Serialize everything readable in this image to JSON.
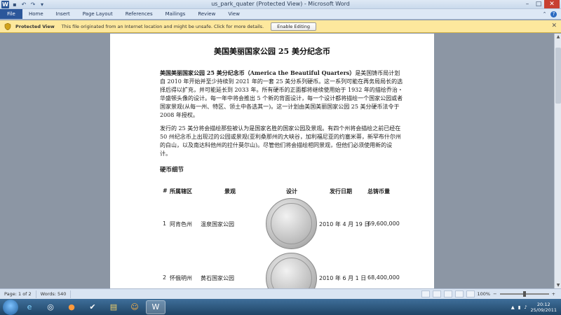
{
  "window": {
    "title": "us_park_quater (Protected View) - Microsoft Word",
    "app_icon": "W"
  },
  "ribbon": {
    "file_tab": "File",
    "tabs": [
      "Home",
      "Insert",
      "Page Layout",
      "References",
      "Mailings",
      "Review",
      "View"
    ]
  },
  "protected_view": {
    "title": "Protected View",
    "message": "This file originated from an Internet location and might be unsafe. Click for more details.",
    "button": "Enable Editing"
  },
  "document": {
    "title": "美国美丽国家公园 25 美分纪念币",
    "p1_bold": "美国美丽国家公园 25 美分纪念币（America the Beautiful Quarters）",
    "p1_rest": "是美国铸币局计划自 2010 年开始并至少持续到 2021 年的一套 25 美分系列硬币。这一系列可能在再务局局长的选择后得以扩充，并可能延长到 2033 年。所有硬币的正面都将继续使用始于 1932 年的描绘乔治・华盛顿头像的设计。每一年中将会推出 5 个新的背面设计，每一个设计都将描绘一个国家公园或者国家景观(从每一州、特区、领土中各选其一)。这一计划由美国美丽国家公园 25 美分硬币法令于 2008 年授权。",
    "p2": "发行的 25 美分将会描绘那些被认为是国家名胜的国家公园及景观。有四个州将会描绘之前已经在 50 州纪念币上出现过的公园或景观(亚利桑那州的大峡谷，加利福尼亚的约塞米蒂，新罕布什尔州的白山，以及南达科他州的拉什莫尔山)。尽管他们将会描绘相同景观，但他们必须使用新的设计。",
    "section_heading": "硬币细节",
    "table": {
      "headers": [
        "#",
        "所属辖区",
        "景观",
        "设计",
        "发行日期",
        "总铸币量"
      ],
      "rows": [
        {
          "num": "1",
          "region": "阿肯色州",
          "site": "温泉国家公园",
          "date": "2010 年 4 月 19 日",
          "mintage": "69,600,000"
        },
        {
          "num": "2",
          "region": "怀俄明州",
          "site": "黄石国家公园",
          "date": "2010 年 6 月 1 日",
          "mintage": "68,400,000"
        }
      ]
    }
  },
  "status": {
    "page": "Page: 1 of 2",
    "words": "Words: 540",
    "zoom": "100%"
  },
  "taskbar": {
    "time": "20:12",
    "date": "25/09/2011"
  },
  "colors": {
    "file_tab": "#2b579a",
    "protected_bar": "#fde89d",
    "close_button": "#c84031"
  }
}
